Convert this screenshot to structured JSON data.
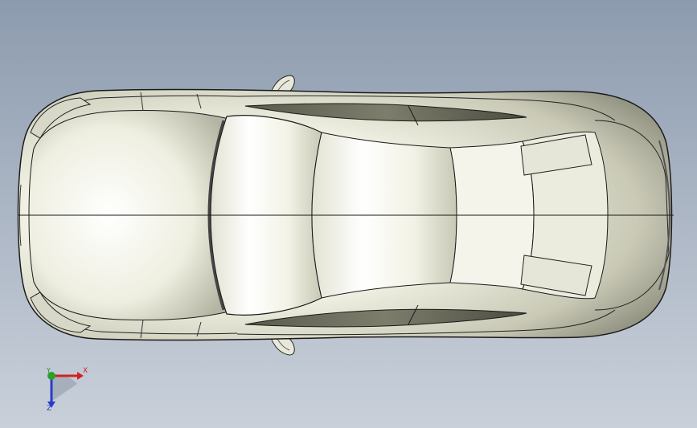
{
  "view": {
    "background_top": "#8c9bae",
    "background_bottom": "#c9d0da",
    "body_color": "#f2f2ea",
    "edge_color": "#1a1a1a"
  },
  "triad": {
    "x_label": "X",
    "y_label": "Y",
    "z_label": "Z",
    "x_color": "#d42020",
    "y_color": "#2a8a2a",
    "z_color": "#2a3cc8"
  }
}
